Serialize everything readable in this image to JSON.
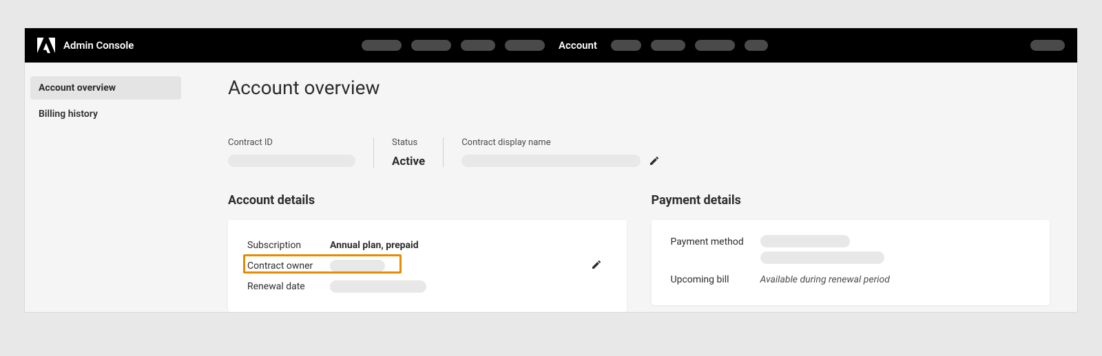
{
  "header": {
    "app_name": "Admin Console",
    "active_tab": "Account"
  },
  "sidebar": {
    "items": [
      {
        "label": "Account overview",
        "active": true
      },
      {
        "label": "Billing history",
        "active": false
      }
    ]
  },
  "page": {
    "title": "Account overview"
  },
  "contract": {
    "id_label": "Contract ID",
    "status_label": "Status",
    "status_value": "Active",
    "display_name_label": "Contract display name"
  },
  "account_details": {
    "section_title": "Account details",
    "subscription_label": "Subscription",
    "subscription_value": "Annual plan, prepaid",
    "contract_owner_label": "Contract owner",
    "renewal_date_label": "Renewal date"
  },
  "payment_details": {
    "section_title": "Payment details",
    "payment_method_label": "Payment method",
    "upcoming_bill_label": "Upcoming bill",
    "upcoming_bill_value": "Available during renewal period"
  }
}
